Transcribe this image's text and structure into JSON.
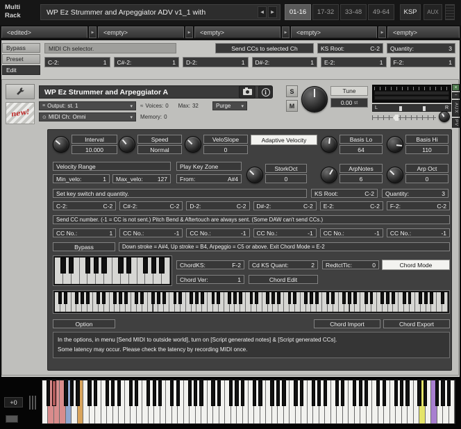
{
  "top_bar": {
    "app_line1": "Multi",
    "app_line2": "Rack",
    "title": "WP Ez Strummer and Arpeggiator ADV v1_1 with",
    "page_tabs": [
      {
        "label": "01-16",
        "active": true
      },
      {
        "label": "17-32",
        "active": false
      },
      {
        "label": "33-48",
        "active": false
      },
      {
        "label": "49-64",
        "active": false
      }
    ],
    "ksp": "KSP",
    "aux": "AUX"
  },
  "icons": {
    "left": "◀",
    "right": "▶",
    "down": "▾",
    "close": "×",
    "minimize": "−",
    "info": "i",
    "output": "≡",
    "midi": "⊙",
    "waves": "≈"
  },
  "slot_tabs": [
    "<edited>",
    "<empty>",
    "<empty>",
    "<empty>",
    "<empty>"
  ],
  "sidebar": {
    "bypass": "Bypass",
    "preset": "Preset",
    "edit": "Edit"
  },
  "header": {
    "midi_ch_selector": "MIDI Ch selector.",
    "send_ccs": "Send CCs to selected Ch",
    "ks_root": {
      "label": "KS Root:",
      "value": "C-2"
    },
    "quantity": {
      "label": "Quantity:",
      "value": "3"
    },
    "ch_fields": [
      {
        "label": "C-2:",
        "value": "1"
      },
      {
        "label": "C#-2:",
        "value": "1"
      },
      {
        "label": "D-2:",
        "value": "1"
      },
      {
        "label": "D#-2:",
        "value": "1"
      },
      {
        "label": "E-2:",
        "value": "1"
      },
      {
        "label": "F-2:",
        "value": "1"
      }
    ]
  },
  "instrument": {
    "title": "WP Ez Strummer and Arpeggiator A",
    "output": {
      "label": "Output:",
      "value": "st. 1"
    },
    "voices": {
      "label": "Voices:",
      "value": "0"
    },
    "max": {
      "label": "Max:",
      "value": "32"
    },
    "purge": "Purge",
    "midi_ch": {
      "label": "MIDI Ch:",
      "value": "Omni"
    },
    "memory": {
      "label": "Memory:",
      "value": "0"
    },
    "solo": "S",
    "mute": "M",
    "tune_label": "Tune",
    "tune_value": "0.00",
    "tune_unit": "st",
    "pan_left": "L",
    "pan_right": "R",
    "new_badge": "new!",
    "aux": "AUX",
    "pv": "PV"
  },
  "panel": {
    "interval": {
      "label": "Interval",
      "value": "10.000"
    },
    "speed": {
      "label": "Speed",
      "value": "Normal"
    },
    "veloslope": {
      "label": "VeloSlope",
      "value": "0"
    },
    "adaptive_velocity": "Adaptive Velocity",
    "basis_lo": {
      "label": "Basis Lo",
      "value": "64"
    },
    "basis_hi": {
      "label": "Basis Hi",
      "value": "110"
    },
    "velocity_range": "Velocity Range",
    "min_velo": {
      "label": "Min_velo:",
      "value": "1"
    },
    "max_velo": {
      "label": "Max_velo:",
      "value": "127"
    },
    "play_key_zone": "Play Key Zone",
    "from": {
      "label": "From:",
      "value": "A#4"
    },
    "stork_oct": {
      "label": "StorkOct",
      "value": "0"
    },
    "arp_notes": {
      "label": "ArpNotes",
      "value": "6"
    },
    "arp_oct": {
      "label": "Arp Oct",
      "value": "0"
    },
    "set_ks": "Set key switch and quantity.",
    "ks_root": {
      "label": "KS Root:",
      "value": "C-2"
    },
    "quantity": {
      "label": "Quantity:",
      "value": "3"
    },
    "ks_fields": [
      {
        "label": "C-2:",
        "value": "C-2"
      },
      {
        "label": "C#-2:",
        "value": "C-2"
      },
      {
        "label": "D-2:",
        "value": "C-2"
      },
      {
        "label": "D#-2:",
        "value": "C-2"
      },
      {
        "label": "E-2:",
        "value": "C-2"
      },
      {
        "label": "F-2:",
        "value": "C-2"
      }
    ],
    "cc_banner": "Send CC number.  (-1 = CC is not sent.)   Pitch Bend & Aftertouch are always sent.   (Some DAW can't send CCs.)",
    "cc_fields": [
      {
        "label": "CC No.:",
        "value": "1"
      },
      {
        "label": "CC No.:",
        "value": "-1"
      },
      {
        "label": "CC No.:",
        "value": "-1"
      },
      {
        "label": "CC No.:",
        "value": "-1"
      },
      {
        "label": "CC No.:",
        "value": "-1"
      },
      {
        "label": "CC No.:",
        "value": "-1"
      }
    ],
    "bypass": "Bypass",
    "stroke_banner": "Down stroke = A#4, Up stroke = B4, Arpeggio = C5 or above.  Exit Chord Mode = E-2",
    "chord_ks": {
      "label": "ChordKS:",
      "value": "F-2"
    },
    "cd_ks_quant": {
      "label": "Cd KS Quant:",
      "value": "2"
    },
    "redtct_tic": {
      "label": "RedtctTic:",
      "value": "0"
    },
    "chord_mode": "Chord Mode",
    "chord_ver": {
      "label": "Chord Ver:",
      "value": "1"
    },
    "chord_edit": "Chord Edit",
    "option": "Option",
    "chord_import": "Chord Import",
    "chord_export": "Chord Export",
    "info_line1": "In the options, in menu [Send MIDI to outside world], turn on [Script generated notes] & [Script generated CCs].",
    "info_line2": "Some latency may occur. Please check the latency by recording MIDI once."
  },
  "bottom": {
    "octave": "+0"
  },
  "keyboards": {
    "chord_mini": {
      "white": 14
    },
    "range_wide": {
      "white": 72
    },
    "main": {
      "white": 70,
      "colored_white": {
        "1": "#d98c8c",
        "2": "#d98c8c",
        "3": "#d98c8c",
        "4": "#8fa6cf",
        "6": "#d9a45c",
        "64": "#e4e46a",
        "66": "#a87fd0"
      },
      "colored_black": {
        "1": "#b25c5c",
        "2": "#b25c5c",
        "65": "#8a5fb2"
      }
    }
  },
  "colors": {
    "white_button": "#f3f3f0",
    "panel_bg": "#404040"
  }
}
